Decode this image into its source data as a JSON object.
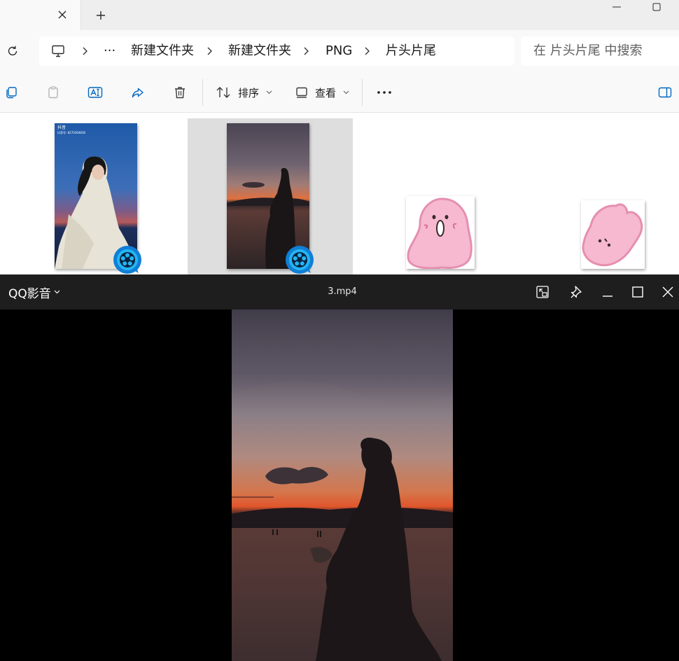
{
  "explorer": {
    "tab_close": "×",
    "new_tab": "+",
    "breadcrumb": {
      "ellipsis": "···",
      "items": [
        "新建文件夹",
        "新建文件夹",
        "PNG",
        "片头片尾"
      ]
    },
    "search": {
      "placeholder": "在 片头片尾 中搜索"
    },
    "toolbar": {
      "sort_label": "排序",
      "view_label": "查看",
      "more_label": "···"
    },
    "files": [
      {
        "kind": "video-thumbnail",
        "badge": "qq-player-icon",
        "overlay_text": [
          "抖音",
          "抖音号: 8270364836"
        ]
      },
      {
        "kind": "video-thumbnail",
        "badge": "qq-player-icon",
        "selected": true
      },
      {
        "kind": "image-thumbnail"
      },
      {
        "kind": "image-thumbnail"
      }
    ]
  },
  "player": {
    "app_name": "QQ影音",
    "title": "3.mp4"
  },
  "colors": {
    "accent": "#0067c0",
    "qq_blue": "#1a9be8",
    "player_bar": "#1e1e1e",
    "selection": "#dedede"
  }
}
